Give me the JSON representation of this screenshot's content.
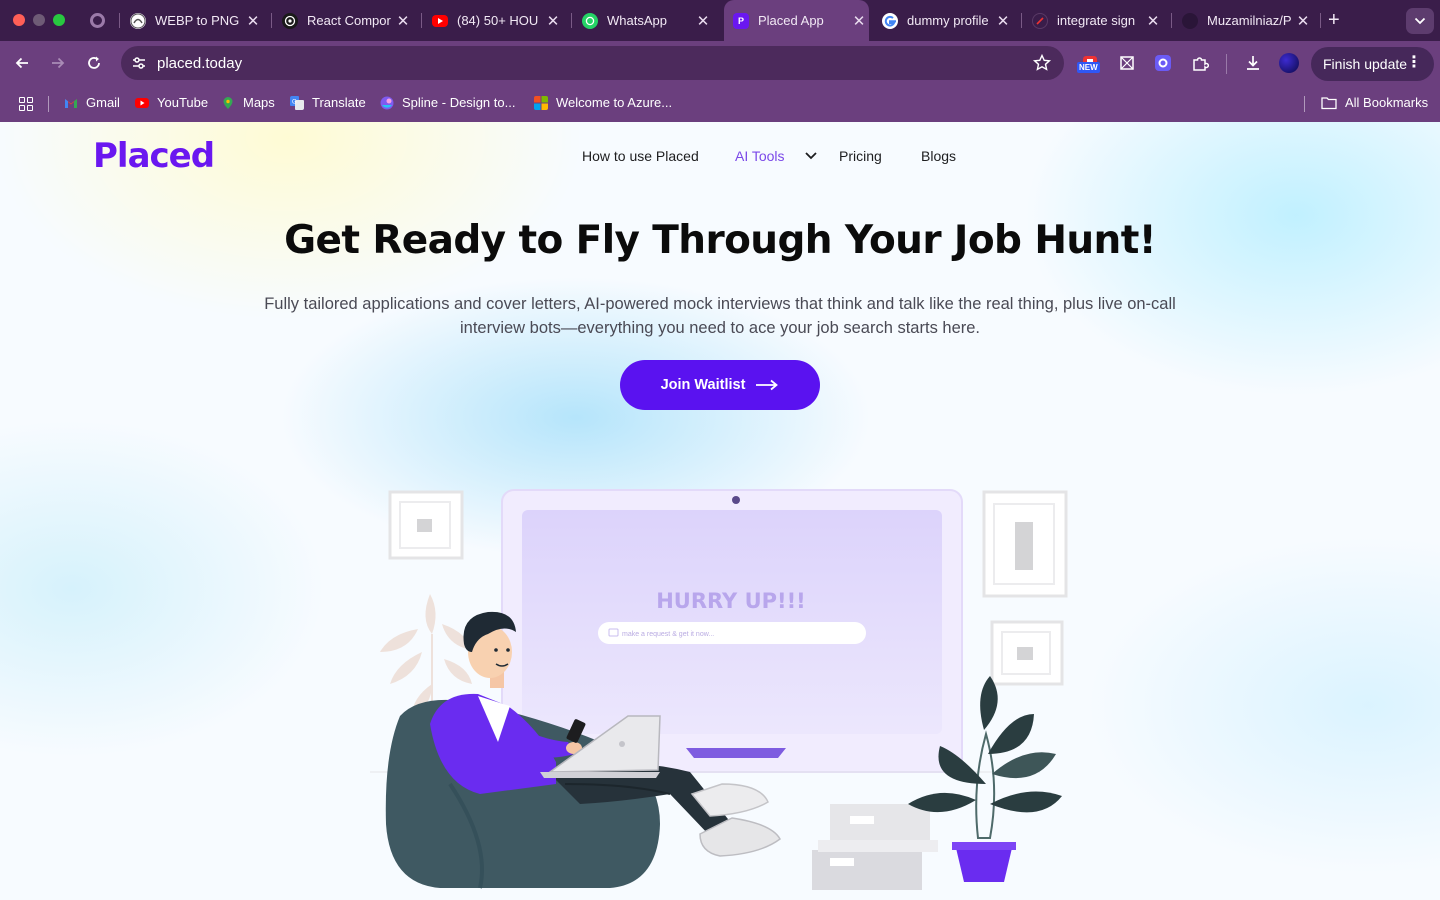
{
  "browser": {
    "tabs": [
      {
        "title": "WEBP to PNG",
        "icon": "webp-converter-icon"
      },
      {
        "title": "React Compor",
        "icon": "openai-icon"
      },
      {
        "title": "(84) 50+ HOU",
        "icon": "youtube-icon"
      },
      {
        "title": "WhatsApp",
        "icon": "whatsapp-icon"
      },
      {
        "title": "Placed App",
        "icon": "placed-icon",
        "active": true
      },
      {
        "title": "dummy profile",
        "icon": "google-icon"
      },
      {
        "title": "integrate sign",
        "icon": "clerk-icon"
      },
      {
        "title": "Muzamilniaz/P",
        "icon": "github-icon"
      }
    ],
    "url": "placed.today",
    "new_badge": "NEW",
    "finish_update": "Finish update",
    "bookmarks": [
      {
        "label": "Gmail",
        "icon": "gmail-icon"
      },
      {
        "label": "YouTube",
        "icon": "youtube-icon"
      },
      {
        "label": "Maps",
        "icon": "maps-icon"
      },
      {
        "label": "Translate",
        "icon": "translate-icon"
      },
      {
        "label": "Spline - Design to...",
        "icon": "spline-icon"
      },
      {
        "label": "Welcome to Azure...",
        "icon": "microsoft-icon"
      }
    ],
    "all_bookmarks": "All Bookmarks",
    "colors": {
      "frame": "#3a1d4a",
      "toolbar": "#6b3f7e",
      "omnibox": "#4c2a5c"
    }
  },
  "site": {
    "logo": "Placed",
    "nav": [
      "How to use Placed",
      "AI Tools",
      "Pricing",
      "Blogs"
    ],
    "hero": {
      "title": "Get Ready to Fly Through Your Job Hunt!",
      "subtitle_line1": "Fully tailored applications and cover letters, AI-powered mock interviews that think and talk like the real thing, plus live on-call",
      "subtitle_line2": "interview bots—everything you need to ace your job search starts here."
    },
    "cta": "Join Waitlist",
    "illustration": {
      "headline": "HURRY UP!!!",
      "input_placeholder": "make a request & get it now..."
    },
    "colors": {
      "brand": "#5a12f0",
      "logo": "#6a17f0",
      "nav_active": "#7b48e8"
    }
  }
}
